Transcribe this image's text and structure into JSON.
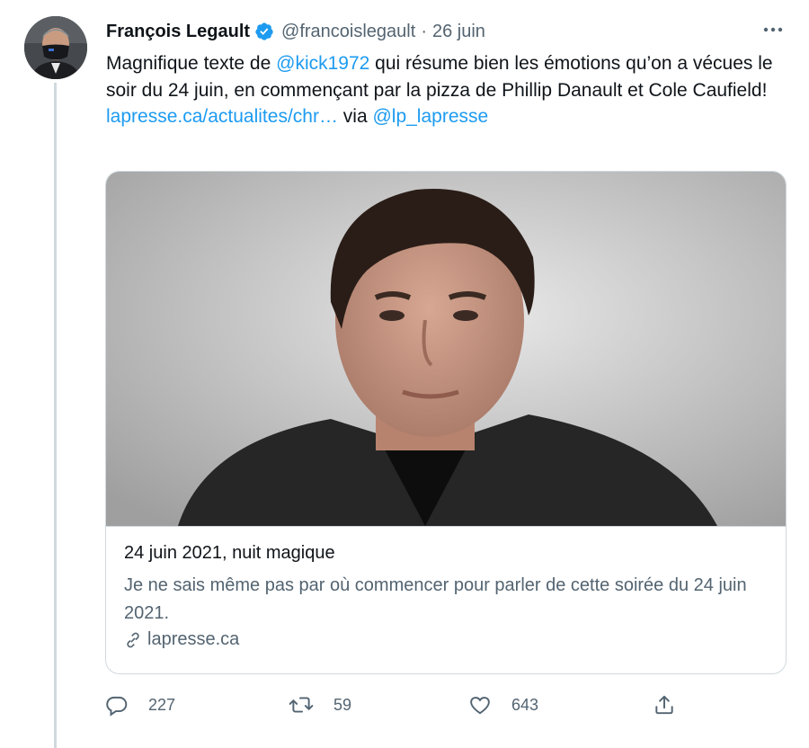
{
  "tweet": {
    "author_name": "François Legault",
    "handle": "@francoislegault",
    "separator": "·",
    "date": "26 juin",
    "text": {
      "part1": "Magnifique texte de ",
      "mention1": "@kick1972",
      "part2": " qui résume bien les émotions qu’on a vécues le soir du 24 juin, en commençant par la pizza de Phillip Danault et Cole Caufield!",
      "url": "lapresse.ca/actualites/chr…",
      "via": " via ",
      "mention2": "@lp_lapresse"
    },
    "icons": {
      "verified": "verified-badge-icon",
      "more": "more-options-icon"
    }
  },
  "card": {
    "title": "24 juin 2021, nuit magique",
    "description": "Je ne sais même pas par où commencer pour parler de cette soirée du 24 juin 2021.",
    "domain": "lapresse.ca",
    "domain_icon": "link-icon"
  },
  "actions": {
    "reply_count": "227",
    "retweet_count": "59",
    "like_count": "643",
    "icons": [
      "reply-icon",
      "retweet-icon",
      "like-icon",
      "share-icon"
    ]
  },
  "colors": {
    "link": "#1d9bf0",
    "secondary_text": "#536471",
    "border": "#cfd9de"
  }
}
